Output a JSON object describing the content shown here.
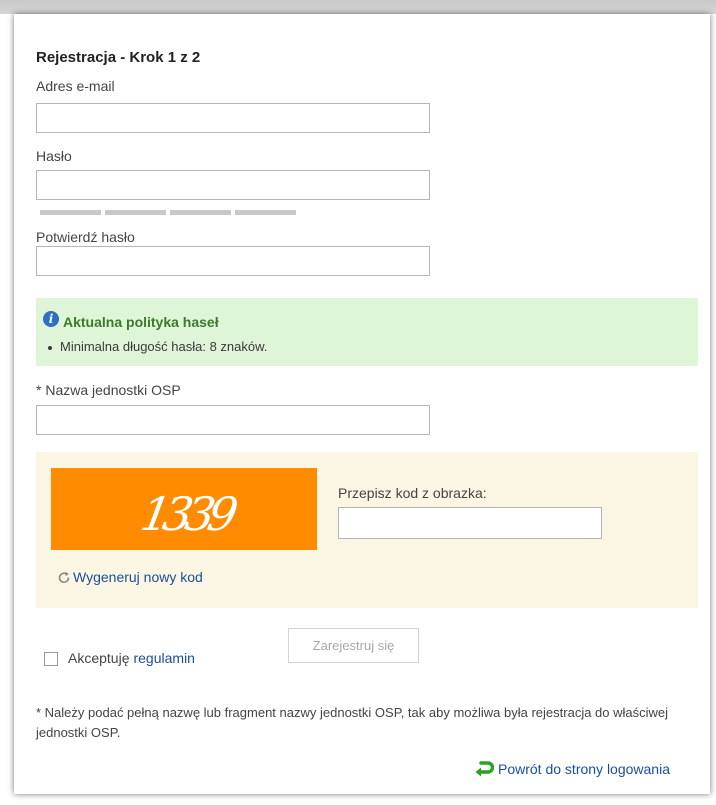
{
  "form": {
    "title": "Rejestracja - Krok 1 z 2",
    "email_label": "Adres e-mail",
    "email_value": "",
    "password_label": "Hasło",
    "password_value": "",
    "password_strength_level": 0,
    "password_strength_segments": 4,
    "confirm_label": "Potwierdź hasło",
    "confirm_value": "",
    "unit_label": "* Nazwa jednostki OSP",
    "unit_value": ""
  },
  "policy": {
    "icon": "info-icon",
    "icon_glyph": "i",
    "title": "Aktualna polityka haseł",
    "items": [
      "Minimalna długość hasła: 8 znaków."
    ],
    "background_color": "#dff5d8",
    "title_color": "#3c7a2a"
  },
  "captcha": {
    "image_code": "1339",
    "refresh_icon": "refresh-icon",
    "refresh_label": "Wygeneruj nowy kod",
    "input_label": "Przepisz kod z obrazka:",
    "input_value": "",
    "image_background": "#ff8c00",
    "box_background": "#fbf5e3"
  },
  "accept": {
    "checked": false,
    "label": "Akceptuję",
    "link": "regulamin"
  },
  "register_button": "Zarejestruj się",
  "note": "* Należy podać pełną nazwę lub fragment nazwy jednostki OSP, tak aby możliwa była rejestracja do właściwej jednostki OSP.",
  "back": {
    "icon": "return-arrow-icon",
    "label": "Powrót do strony logowania"
  },
  "colors": {
    "link": "#1a4fa0",
    "accent_green": "#2aa31f"
  }
}
